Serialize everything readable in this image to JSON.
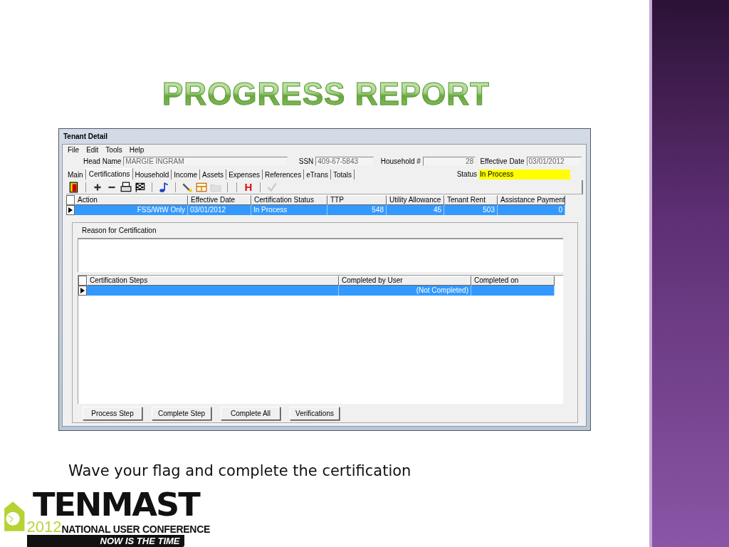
{
  "slide": {
    "title": "PROGRESS REPORT",
    "caption": "Wave your flag and complete the certification"
  },
  "window": {
    "title": "Tenant Detail",
    "menu": [
      "File",
      "Edit",
      "Tools",
      "Help"
    ],
    "header": {
      "head_name_label": "Head Name",
      "head_name": "MARGIE INGRAM",
      "ssn_label": "SSN",
      "ssn": "409-67-5843",
      "household_label": "Household #",
      "household": "28",
      "effective_date_label": "Effective Date",
      "effective_date": "03/01/2012"
    },
    "tabs": [
      {
        "label": "Main",
        "selected": false
      },
      {
        "label": "Certifications",
        "selected": true
      },
      {
        "label": "Household",
        "selected": false
      },
      {
        "label": "Income",
        "selected": false
      },
      {
        "label": "Assets",
        "selected": false
      },
      {
        "label": "Expenses",
        "selected": false
      },
      {
        "label": "References",
        "selected": false
      },
      {
        "label": "eTrans",
        "selected": false
      },
      {
        "label": "Totals",
        "selected": false
      }
    ],
    "status_label": "Status",
    "status": "In Process",
    "toolbar": [
      {
        "kind": "exit",
        "disabled": false
      },
      {
        "kind": "separator"
      },
      {
        "kind": "add",
        "disabled": false
      },
      {
        "kind": "remove",
        "disabled": false
      },
      {
        "kind": "print",
        "disabled": false
      },
      {
        "kind": "flag",
        "disabled": false
      },
      {
        "kind": "separator"
      },
      {
        "kind": "note",
        "disabled": false
      },
      {
        "kind": "separator"
      },
      {
        "kind": "pen",
        "disabled": false
      },
      {
        "kind": "table",
        "disabled": false
      },
      {
        "kind": "folder",
        "disabled": true
      },
      {
        "kind": "separator"
      },
      {
        "kind": "separator"
      },
      {
        "kind": "letter",
        "text": "H",
        "disabled": false
      },
      {
        "kind": "separator"
      },
      {
        "kind": "check",
        "disabled": true
      }
    ],
    "certifications": {
      "columns": [
        "Action",
        "Effective Date",
        "Certification Status",
        "TTP",
        "Utility Allowance",
        "Tenant Rent",
        "Assistance Payment"
      ],
      "rows": [
        {
          "selected": true,
          "cells": [
            "FSS/WtW Only",
            "03/01/2012",
            "In Process",
            "548",
            "45",
            "503",
            "0"
          ]
        }
      ]
    },
    "reason_label": "Reason for Certification",
    "steps": {
      "columns": [
        "Certification Steps",
        "Completed by User",
        "Completed on"
      ],
      "rows": [
        {
          "selected": true,
          "completed_by_user": "(Not Completed)"
        }
      ]
    },
    "buttons": [
      "Process Step",
      "Complete Step",
      "Complete All",
      "Verifications"
    ]
  },
  "logo": {
    "name": "TENMAST",
    "year": "2012",
    "subtitle": "NATIONAL USER CONFERENCE",
    "tagline": "NOW IS THE TIME"
  }
}
